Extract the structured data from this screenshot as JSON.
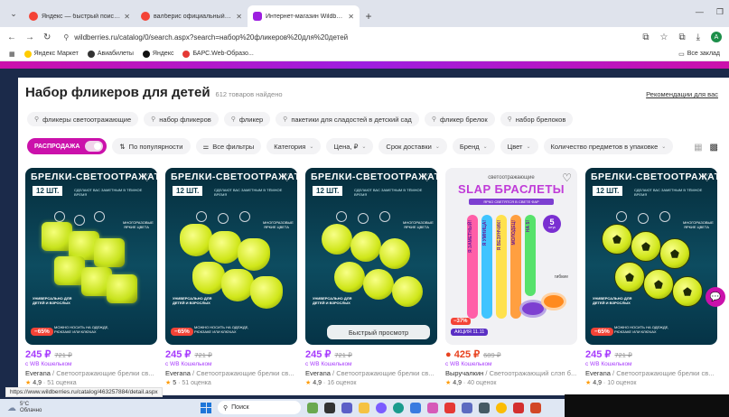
{
  "browser": {
    "tabs": [
      {
        "title": "Яндекс — быстрый поиск в и...",
        "favicon_color": "#f44336",
        "active": false
      },
      {
        "title": "валберис официальный сайт –...",
        "favicon_color": "#f44336",
        "active": false
      },
      {
        "title": "Интернет-магазин Wildberries...",
        "favicon_color": "#9d1ee0",
        "active": true
      }
    ],
    "url": "wildberries.ru/catalog/0/search.aspx?search=набор%20фликеров%20для%20детей",
    "bookmarks": [
      "Яндекс Маркет",
      "Авиабилеты",
      "Яндекс",
      "БАРС.Web-Образо..."
    ],
    "bookmarks_right": "Все заклад",
    "profile_initial": "A",
    "status_url": "https://www.wildberries.ru/catalog/463257884/detail.aspx"
  },
  "page": {
    "title": "Набор фликеров для детей",
    "count": "612 товаров найдено",
    "recommend": "Рекомендации для вас",
    "chips": [
      "фликеры светоотражающие",
      "набор фликеров",
      "фликер",
      "пакетики для сладостей в детский сад",
      "фликер брелок",
      "набор брелоков"
    ],
    "sale_label": "РАСПРОДАЖА",
    "filters": [
      {
        "label": "По популярности",
        "icon": "sort-icon"
      },
      {
        "label": "Все фильтры",
        "icon": "filter-icon"
      },
      {
        "label": "Категория",
        "chev": true
      },
      {
        "label": "Цена, ₽",
        "chev": true
      },
      {
        "label": "Срок доставки",
        "chev": true
      },
      {
        "label": "Бренд",
        "chev": true
      },
      {
        "label": "Цвет",
        "chev": true
      },
      {
        "label": "Количество предметов в упаковке",
        "chev": true
      }
    ],
    "accent": "#cb11ab",
    "price_color": "#a73afd"
  },
  "products": [
    {
      "banner": "БРЕЛКИ-СВЕТООТРАЖАТЕЛИ",
      "qty": "12 ШТ.",
      "subtitle": "СДЕЛАЮТ ВАС ЗАМЕТНЫМ В ТЁМНОЕ ВРЕМЯ",
      "side": "МНОГОРАЗОВЫЕ ЯРКИЕ ЦВЕТА",
      "universal": "УНИВЕРСАЛЬНО ДЛЯ ДЕТЕЙ И ВЗРОСЛЫХ",
      "note": "МОЖНО НОСИТЬ НА ОДЕЖДЕ, РЮКЗАКЕ ИЛИ КЛЮЧАХ",
      "discount": "−65%",
      "price": "245 ₽",
      "old_price": "721 ₽",
      "wallet": "с WB Кошельком",
      "brand": "Everana",
      "name": "Светоотражающие брелки св...",
      "rating": "4,9",
      "reviews": "· 51 оценка",
      "shape": "bear"
    },
    {
      "banner": "БРЕЛКИ-СВЕТООТРАЖАТЕЛИ",
      "qty": "12 ШТ.",
      "subtitle": "СДЕЛАЮТ ВАС ЗАМЕТНЫМ В ТЁМНОЕ ВРЕМЯ",
      "side": "МНОГОРАЗОВЫЕ ЯРКИЕ ЦВЕТА",
      "universal": "УНИВЕРСАЛЬНО ДЛЯ ДЕТЕЙ И ВЗРОСЛЫХ",
      "note": "МОЖНО НОСИТЬ НА ОДЕЖДЕ, РЮКЗАКЕ ИЛИ КЛЮЧАХ",
      "discount": "−65%",
      "price": "245 ₽",
      "old_price": "721 ₽",
      "wallet": "с WB Кошельком",
      "brand": "Everana",
      "name": "Светоотражающие брелки св...",
      "rating": "5",
      "reviews": "· 51 оценка",
      "shape": "cat"
    },
    {
      "banner": "БРЕЛКИ-СВЕТООТРАЖАТЕЛИ",
      "qty": "12 ШТ.",
      "subtitle": "СДЕЛАЮТ ВАС ЗАМЕТНЫМ В ТЁМНОЕ ВРЕМЯ",
      "side": "МНОГОРАЗОВЫЕ ЯРКИЕ ЦВЕТА",
      "universal": "УНИВЕРСАЛЬНО ДЛЯ ДЕТЕЙ И ВЗРОСЛЫХ",
      "note": "",
      "discount": "",
      "quick_view": "Быстрый просмотр",
      "price": "245 ₽",
      "old_price": "721 ₽",
      "wallet": "с WB Кошельком",
      "brand": "Everana",
      "name": "Светоотражающие брелки св...",
      "rating": "4,9",
      "reviews": "· 16 оценок",
      "shape": "smile"
    },
    {
      "banner": "светоотражающие",
      "big": "SLAP БРАСЛЕТЫ",
      "subtitle": "ЯРКО СВЕТЯТСЯ В СВЕТЕ ФАР",
      "badge_num": "5",
      "badge_txt": "штук",
      "flex_label": "гибкие",
      "band_words": [
        "Я ЗАМЕТНЫЙ!",
        "Я УМНИЦА!",
        "Я ВЕЗУНЧИК!",
        "МОЛОДЕЦ!",
        "НА 5!"
      ],
      "discount": "−37%",
      "promo": "АКЦИЯ 11.11",
      "price": "425 ₽",
      "old_price": "689 ₽",
      "wallet": "с WB Кошельком",
      "brand": "Выручалкин",
      "name": "Светоотражающий слэп б...",
      "rating": "4,9",
      "reviews": "· 40 оценок",
      "shape": "slap",
      "hot": true
    },
    {
      "banner": "БРЕЛКИ-СВЕТООТРАЖАТЕЛИ",
      "qty": "12 ШТ.",
      "subtitle": "СДЕЛАЮТ ВАС ЗАМЕТНЫМ В ТЁМНОЕ ВРЕМЯ",
      "side": "МНОГОРАЗОВЫЕ ЯРКИЕ ЦВЕТА",
      "universal": "УНИВЕРСАЛЬНО ДЛЯ ДЕТЕЙ И ВЗРОСЛЫХ",
      "note": "МОЖНО НОСИТЬ НА ОДЕЖДЕ, РЮКЗАКЕ ИЛИ КЛЮЧАХ",
      "discount": "−65%",
      "price": "245 ₽",
      "old_price": "721 ₽",
      "wallet": "с WB Кошельком",
      "brand": "Everana",
      "name": "Светоотражающие брелки св...",
      "rating": "4,9",
      "reviews": "· 10 оценок",
      "shape": "ball"
    }
  ],
  "taskbar": {
    "temp": "5°C",
    "weather": "Облачно",
    "search": "Поиск"
  }
}
